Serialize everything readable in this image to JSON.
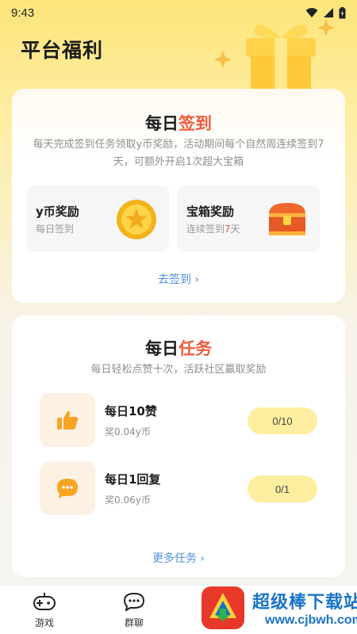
{
  "status_bar": {
    "time": "9:43"
  },
  "page": {
    "title": "平台福利"
  },
  "checkin": {
    "title_prefix": "每日",
    "title_accent": "签到",
    "description": "每天完成签到任务领取y币奖励，活动期间每个自然周连续签到7天，可额外开启1次超大宝箱",
    "rewards": [
      {
        "title": "y币奖励",
        "subtitle": "每日签到",
        "icon": "coin-icon"
      },
      {
        "title": "宝箱奖励",
        "subtitle_prefix": "连续签到",
        "subtitle_highlight": "7",
        "subtitle_suffix": "天",
        "icon": "treasure-chest-icon"
      }
    ],
    "link_label": "去签到"
  },
  "tasks": {
    "title_prefix": "每日",
    "title_accent": "任务",
    "description": "每日轻松点赞十次，活跃社区赢取奖励",
    "items": [
      {
        "title": "每日10赞",
        "reward": "奖0.04y币",
        "progress": "0/10",
        "icon": "thumbs-up-icon"
      },
      {
        "title": "每日1回复",
        "reward": "奖0.06y币",
        "progress": "0/1",
        "icon": "chat-bubble-icon"
      }
    ],
    "more_label": "更多任务"
  },
  "tab_bar": {
    "tabs": [
      {
        "label": "游戏",
        "icon": "gamepad-icon"
      },
      {
        "label": "群聊",
        "icon": "chat-icon"
      }
    ]
  },
  "watermark": {
    "text": "超级棒下载站",
    "url": "www.cjbwh.com"
  },
  "colors": {
    "accent": "#f05a3a",
    "link": "#4f8fe0",
    "progress_bg": "#fdeea0",
    "icon_bg": "#fdf1e4"
  }
}
